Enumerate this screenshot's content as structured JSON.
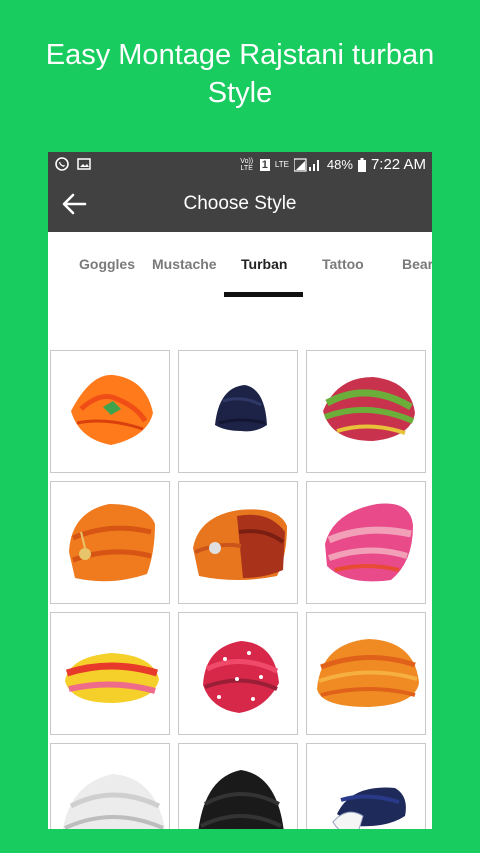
{
  "promo": {
    "line1": "Easy Montage Rajstani turban",
    "line2": "Style"
  },
  "status_bar": {
    "left_icons": [
      "whatsapp-icon",
      "image-icon"
    ],
    "volte": "Vo)) LTE",
    "sim": "1",
    "lte": "LTE",
    "battery_percent": "48%",
    "time": "7:22 AM"
  },
  "app_bar": {
    "title": "Choose Style",
    "back_icon": "arrow-left-icon"
  },
  "tabs": [
    {
      "label": "Goggles",
      "active": false
    },
    {
      "label": "Mustache",
      "active": false
    },
    {
      "label": "Turban",
      "active": true
    },
    {
      "label": "Tattoo",
      "active": false
    },
    {
      "label": "Bear",
      "active": false
    }
  ],
  "turbans": [
    {
      "name": "orange-turban-icon",
      "colors": [
        "#ff7a1a",
        "#f04e16",
        "#3fa34d"
      ]
    },
    {
      "name": "navy-turban-icon",
      "colors": [
        "#1d2347",
        "#121630"
      ]
    },
    {
      "name": "green-pink-turban-icon",
      "colors": [
        "#c8324c",
        "#6cae3a",
        "#e8c33a"
      ]
    },
    {
      "name": "orange-brooch-turban-icon",
      "colors": [
        "#f07a1e",
        "#d65414",
        "#e8c46a"
      ]
    },
    {
      "name": "rust-brooch-turban-icon",
      "colors": [
        "#e8761e",
        "#a8321a",
        "#7a1e12"
      ]
    },
    {
      "name": "pink-multicolor-turban-icon",
      "colors": [
        "#e84a8a",
        "#f2a0b8",
        "#e84b33"
      ]
    },
    {
      "name": "yellow-red-turban-icon",
      "colors": [
        "#f5cf2a",
        "#e83a2a",
        "#ee6b8a"
      ]
    },
    {
      "name": "red-bandhani-turban-icon",
      "colors": [
        "#d8284a",
        "#f04a6a",
        "#9a1f36"
      ]
    },
    {
      "name": "orange-striped-turban-icon",
      "colors": [
        "#f08a22",
        "#e0621a",
        "#f5b040"
      ]
    },
    {
      "name": "white-turban-icon",
      "colors": [
        "#ececec",
        "#cfcfcf",
        "#bdbdbd"
      ]
    },
    {
      "name": "black-turban-icon",
      "colors": [
        "#1a1a1a",
        "#333333"
      ]
    },
    {
      "name": "white-navy-turban-icon",
      "colors": [
        "#1e2a5a",
        "#f5f5f5",
        "#2a3a8a"
      ]
    }
  ],
  "theme": {
    "promo_bg": "#19cc5f",
    "app_bar_bg": "#414141",
    "tab_indicator": "#111111"
  }
}
